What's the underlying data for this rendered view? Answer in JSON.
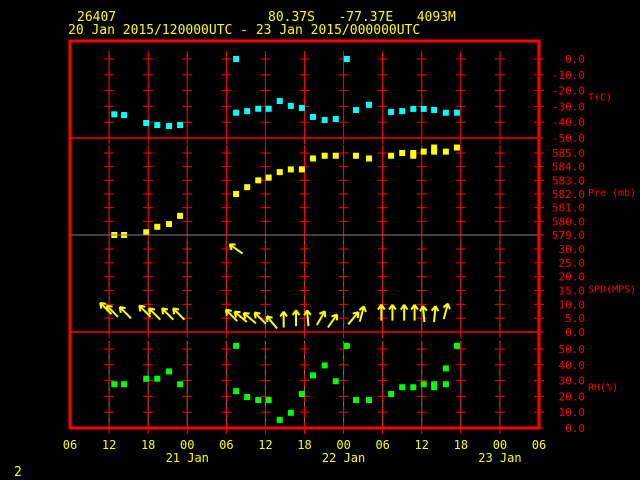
{
  "header": {
    "station_id": "26407",
    "location": "80.37S   -77.37E   4093M",
    "period": "20 Jan 2015/120000UTC - 23 Jan 2015/000000UTC"
  },
  "page_number": "2",
  "colors": {
    "frame": "#ff0000",
    "text": "#ffff00",
    "temp": "#00ffff",
    "pressure": "#ffff00",
    "wind": "#ffff00",
    "rh": "#00ff00",
    "grid_gray": "#808080"
  },
  "chart_data": {
    "type": "scatter",
    "x_unit": "hours since 20 Jan 2015 06 UTC",
    "x_range": [
      0,
      72
    ],
    "x_ticks": [
      "06",
      "12",
      "18",
      "00",
      "06",
      "12",
      "18",
      "00",
      "06",
      "12",
      "18",
      "00",
      "06"
    ],
    "date_labels": [
      {
        "label": "21 Jan",
        "hour": 18
      },
      {
        "label": "22 Jan",
        "hour": 42
      },
      {
        "label": "23 Jan",
        "hour": 66
      }
    ],
    "panels": [
      {
        "id": "temp",
        "title": "T(C)",
        "ylim": [
          -50,
          0
        ],
        "tick_labels": [
          "0.0",
          "-10.0",
          "-20.0",
          "-30.0",
          "-40.0",
          "-50.0"
        ],
        "tick_values": [
          0,
          -10,
          -20,
          -30,
          -40,
          -50
        ],
        "points": [
          [
            6.8,
            -35
          ],
          [
            8.3,
            -35.5
          ],
          [
            11.7,
            -40.5
          ],
          [
            13.4,
            -41.8
          ],
          [
            15.2,
            -42.4
          ],
          [
            16.9,
            -41.8
          ],
          [
            25.5,
            0
          ],
          [
            25.5,
            -34
          ],
          [
            27.2,
            -33
          ],
          [
            28.9,
            -31.5
          ],
          [
            30.5,
            -31.5
          ],
          [
            32.2,
            -26.6
          ],
          [
            33.9,
            -29.7
          ],
          [
            35.6,
            -31
          ],
          [
            37.3,
            -36.7
          ],
          [
            39.1,
            -38.6
          ],
          [
            40.8,
            -38
          ],
          [
            42.5,
            0
          ],
          [
            43.9,
            -32.3
          ],
          [
            45.9,
            -29
          ],
          [
            49.3,
            -33.5
          ],
          [
            51,
            -33
          ],
          [
            52.7,
            -31.6
          ],
          [
            54.3,
            -31.6
          ],
          [
            55.9,
            -32.3
          ],
          [
            57.7,
            -34
          ],
          [
            59.4,
            -34
          ]
        ]
      },
      {
        "id": "pressure",
        "title": "Pre (mb)",
        "ylim": [
          579,
          585
        ],
        "tick_labels": [
          "585.0",
          "584.0",
          "583.0",
          "582.0",
          "581.0",
          "580.0",
          "579.0"
        ],
        "tick_values": [
          585,
          584,
          583,
          582,
          581,
          580,
          579
        ],
        "points": [
          [
            6.8,
            579
          ],
          [
            8.3,
            579
          ],
          [
            11.7,
            579.2
          ],
          [
            13.4,
            579.6
          ],
          [
            15.2,
            579.8
          ],
          [
            16.9,
            580.4
          ],
          [
            25.5,
            582
          ],
          [
            27.2,
            582.5
          ],
          [
            28.9,
            583
          ],
          [
            30.5,
            583.2
          ],
          [
            32.2,
            583.6
          ],
          [
            33.9,
            583.8
          ],
          [
            35.6,
            583.8
          ],
          [
            37.3,
            584.6
          ],
          [
            39.1,
            584.8
          ],
          [
            40.8,
            584.8
          ],
          [
            43.9,
            584.8
          ],
          [
            45.9,
            584.6
          ],
          [
            49.3,
            584.8
          ],
          [
            51,
            585
          ],
          [
            52.7,
            585
          ],
          [
            52.7,
            584.8
          ],
          [
            54.3,
            585.1
          ],
          [
            55.9,
            585.4
          ],
          [
            55.9,
            585.1
          ],
          [
            57.7,
            585.1
          ],
          [
            59.4,
            585.4
          ]
        ]
      },
      {
        "id": "wind",
        "title": "SPD(MPS)",
        "ylim": [
          0,
          30
        ],
        "tick_labels": [
          "30.0",
          "25.0",
          "20.0",
          "15.0",
          "10.0",
          "5.0",
          "0.0"
        ],
        "tick_values": [
          30,
          25,
          20,
          15,
          10,
          5,
          0
        ],
        "arrows": [
          [
            5.5,
            8.5,
            135
          ],
          [
            6.5,
            7.5,
            135
          ],
          [
            8.5,
            7,
            135
          ],
          [
            11.5,
            7.5,
            135
          ],
          [
            13,
            6.5,
            135
          ],
          [
            15,
            6.5,
            135
          ],
          [
            16.7,
            6.5,
            135
          ],
          [
            25.5,
            30,
            125
          ],
          [
            24.8,
            6,
            135
          ],
          [
            26.2,
            5.5,
            130
          ],
          [
            27.6,
            5,
            130
          ],
          [
            29.2,
            5,
            135
          ],
          [
            31,
            3.5,
            140
          ],
          [
            32.8,
            4.5,
            180
          ],
          [
            34.7,
            5,
            180
          ],
          [
            36.5,
            5,
            175
          ],
          [
            38.5,
            5,
            210
          ],
          [
            40.3,
            4,
            215
          ],
          [
            43.5,
            5,
            220
          ],
          [
            44.8,
            6.5,
            195
          ],
          [
            47.8,
            7,
            180
          ],
          [
            49.5,
            7,
            180
          ],
          [
            51.3,
            7,
            180
          ],
          [
            52.9,
            7,
            180
          ],
          [
            54.3,
            6.5,
            175
          ],
          [
            56,
            6.5,
            185
          ],
          [
            57.7,
            7.5,
            195
          ]
        ]
      },
      {
        "id": "rh",
        "title": "RH(%)",
        "ylim": [
          0,
          50
        ],
        "tick_labels": [
          "50.0",
          "40.0",
          "30.0",
          "20.0",
          "10.0",
          "0.0"
        ],
        "tick_values": [
          50,
          40,
          30,
          20,
          10,
          0
        ],
        "points": [
          [
            6.8,
            27.7
          ],
          [
            8.3,
            27.7
          ],
          [
            11.7,
            31.2
          ],
          [
            13.4,
            31.2
          ],
          [
            15.2,
            35.8
          ],
          [
            16.9,
            27.7
          ],
          [
            25.5,
            52
          ],
          [
            25.5,
            23.3
          ],
          [
            27.2,
            19.6
          ],
          [
            28.9,
            17.7
          ],
          [
            30.5,
            17.7
          ],
          [
            32.2,
            5.2
          ],
          [
            33.9,
            9.6
          ],
          [
            35.6,
            21.5
          ],
          [
            37.3,
            33.3
          ],
          [
            39.1,
            39.6
          ],
          [
            40.8,
            29.6
          ],
          [
            42.5,
            52
          ],
          [
            43.9,
            17.7
          ],
          [
            45.9,
            17.7
          ],
          [
            49.3,
            21.5
          ],
          [
            51,
            25.8
          ],
          [
            52.7,
            25.8
          ],
          [
            54.3,
            27.7
          ],
          [
            55.9,
            27.7
          ],
          [
            55.9,
            25.8
          ],
          [
            57.7,
            27.7
          ],
          [
            57.7,
            37.7
          ],
          [
            59.4,
            52
          ]
        ]
      }
    ]
  }
}
